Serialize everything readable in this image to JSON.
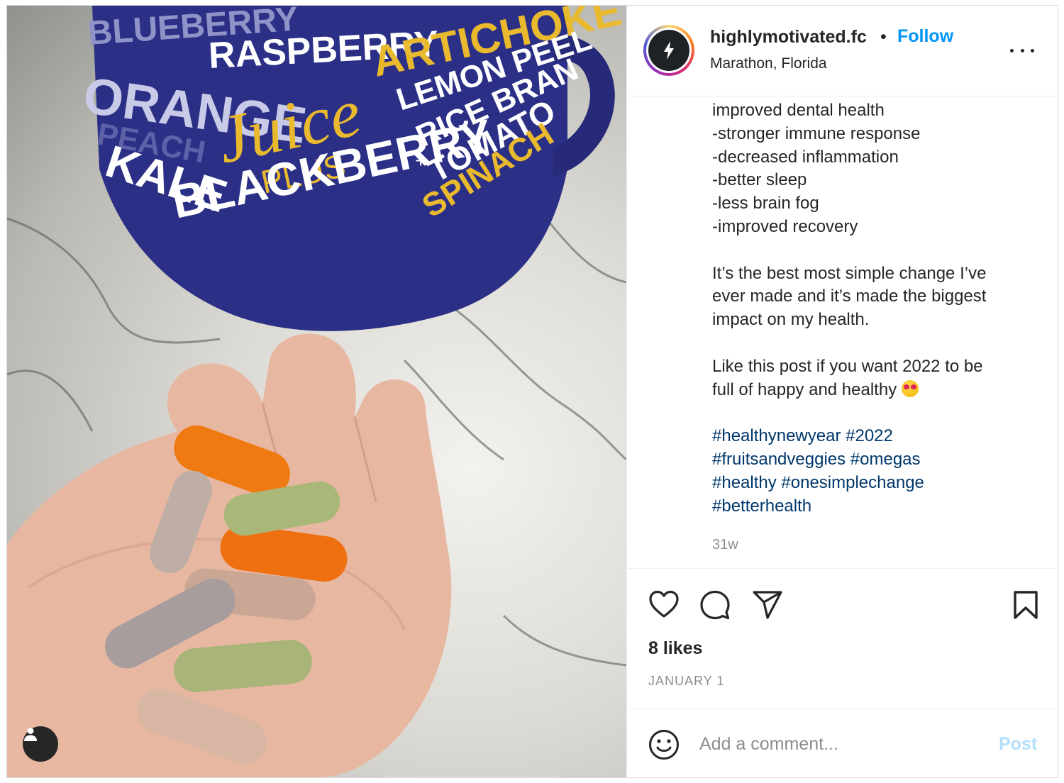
{
  "post": {
    "photo": {
      "description_icon": "person-tag-icon",
      "mug_words": {
        "blueberry": "BLUEBERRY",
        "raspberry": "RASPBERRY",
        "artichoke": "ARTICHOKE",
        "orange": "ORANGE",
        "lemon_peel": "LEMON PEEL",
        "peach": "PEACH",
        "juice": "Juice",
        "rice_bran": "RICE BRAN",
        "kale": "KALE",
        "plus": "PLUS",
        "plus_sign": "+",
        "tomato": "TOMATO",
        "blackberry": "BLACKBERRY",
        "spinach": "SPINACH"
      }
    },
    "header": {
      "username": "highlymotivated.fc",
      "separator": "•",
      "follow_label": "Follow",
      "location": "Marathon, Florida",
      "more_icon": "more-options-icon"
    },
    "caption": {
      "lines_block1": [
        "improved dental health",
        "-stronger immune response",
        "-decreased inflammation",
        "-better sleep",
        "-less brain fog",
        "-improved recovery"
      ],
      "para1_lines": [
        "It’s the best most simple change I’ve",
        "ever made and it’s made the biggest",
        "impact on my health."
      ],
      "para2_line1": "Like this post if you want 2022 to be",
      "para2_line2": "full of happy and healthy",
      "emoji_icon": "heart-eyes-emoji-icon",
      "hashtag_lines": [
        "#healthynewyear #2022",
        "#fruitsandveggies #omegas",
        "#healthy #onesimplechange",
        "#betterhealth"
      ]
    },
    "timestamp": "31w",
    "actions": {
      "like_icon": "heart-icon",
      "comment_icon": "comment-icon",
      "share_icon": "share-icon",
      "save_icon": "bookmark-icon"
    },
    "likes": "8 likes",
    "date": "JANUARY 1",
    "comment": {
      "placeholder": "Add a comment...",
      "value": "",
      "post_label": "Post",
      "emoji_icon": "smiley-icon"
    }
  },
  "colors": {
    "follow": "#0095f6",
    "hashtag": "#00376b",
    "post_disabled": "#b2dffc",
    "mug": "#2b2f86",
    "mug_gold": "#e9b92e"
  }
}
